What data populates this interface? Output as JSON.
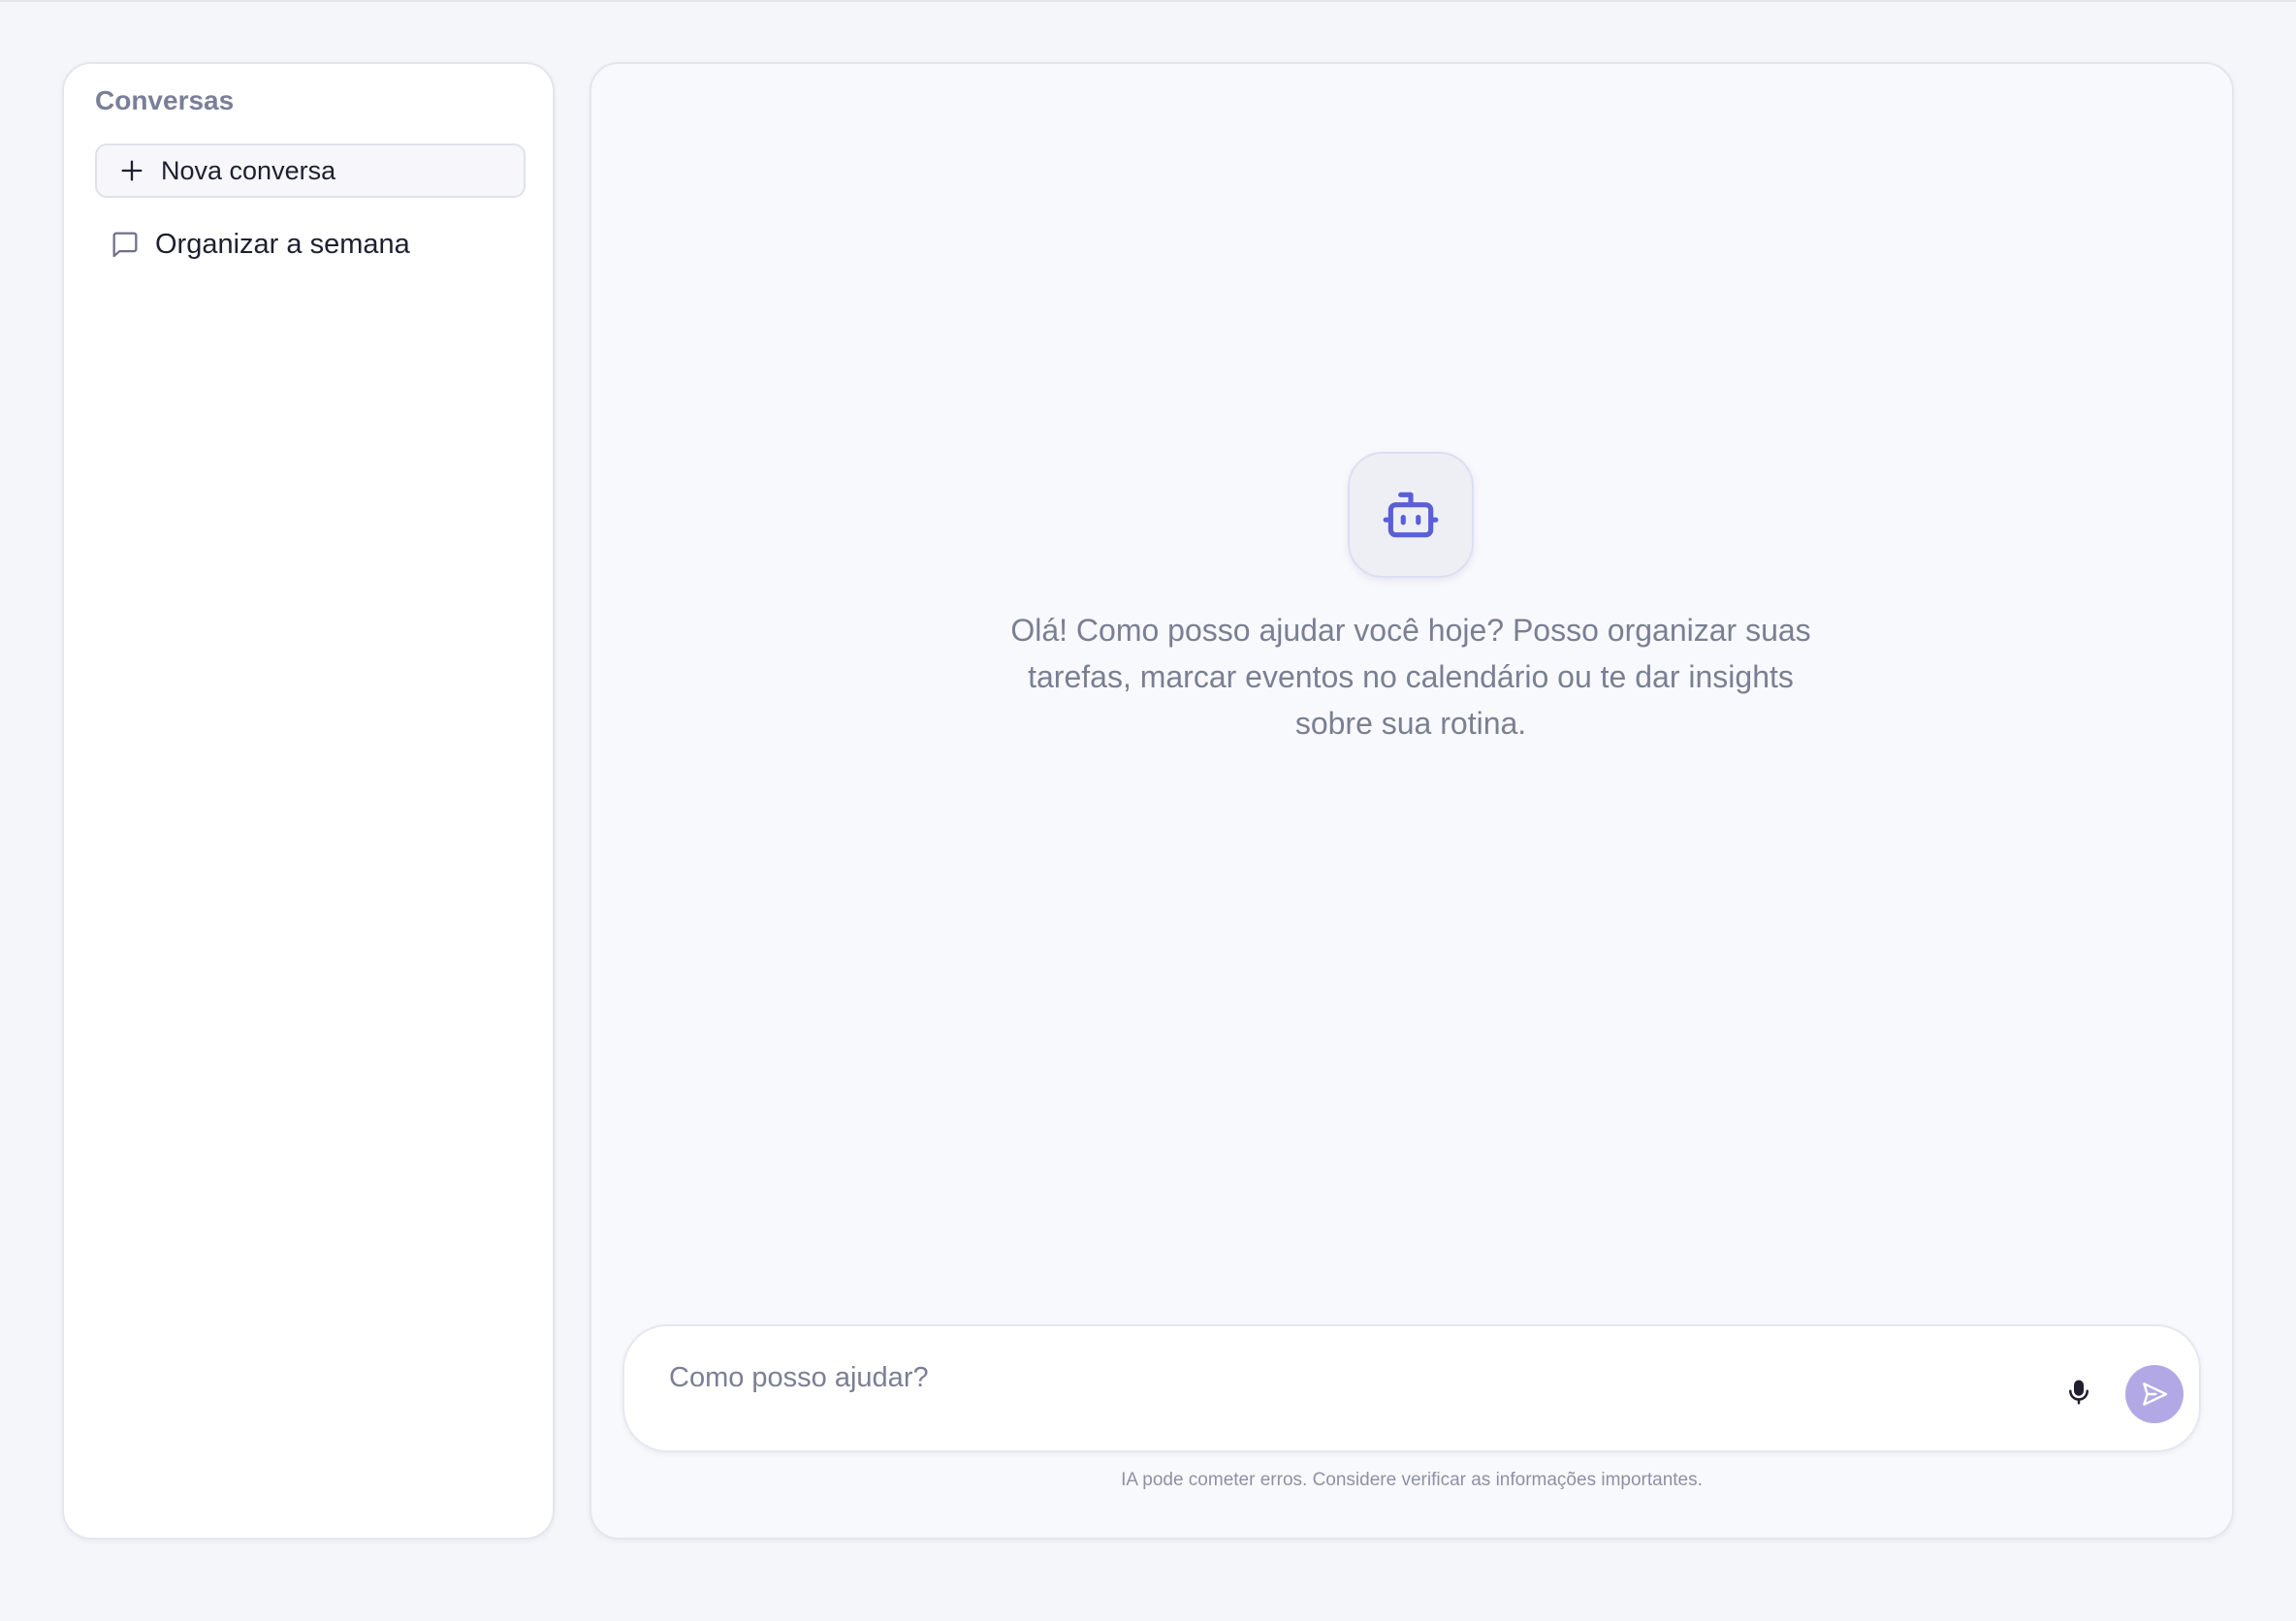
{
  "sidebar": {
    "title": "Conversas",
    "new_chat_label": "Nova conversa",
    "conversations": [
      {
        "label": "Organizar a semana",
        "icon": "chat-bubble-icon"
      }
    ]
  },
  "main": {
    "assistant_icon": "bot-icon",
    "welcome_message": "Olá! Como posso ajudar você hoje? Posso organizar suas tarefas, marcar eventos no calendário ou te dar insights sobre sua rotina.",
    "composer": {
      "placeholder": "Como posso ajudar?",
      "value": "",
      "mic_icon": "microphone-icon",
      "send_icon": "send-icon"
    },
    "disclaimer": "IA pode cometer erros. Considere verificar as informações importantes."
  },
  "colors": {
    "page_background": "#f5f6fa",
    "accent": "#5b5fd6",
    "send_button": "#b3a8e6",
    "muted_text": "#7b7f93"
  }
}
